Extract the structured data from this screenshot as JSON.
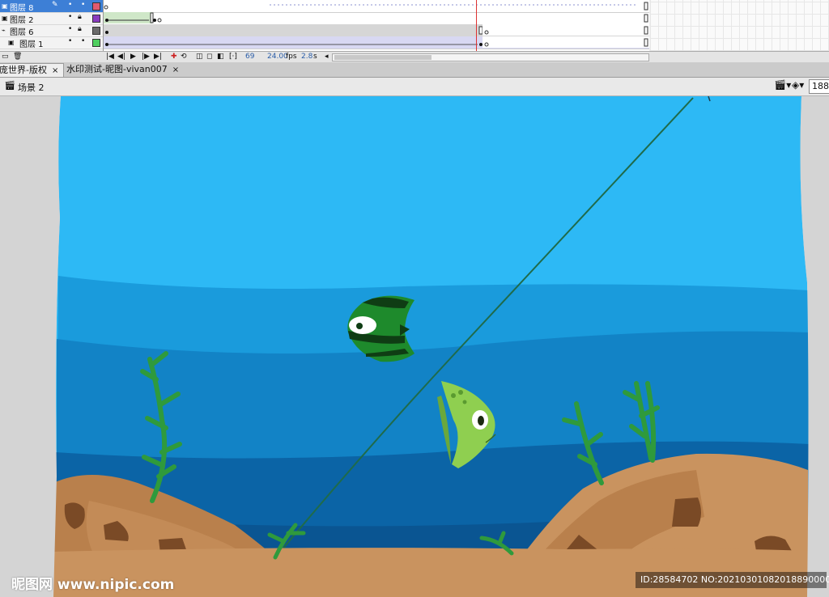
{
  "timeline": {
    "layers": [
      {
        "name": "图层 8",
        "selected": true,
        "color": "#e05a6e",
        "locked": false
      },
      {
        "name": "图层 2",
        "selected": false,
        "color": "#8a3cbf",
        "locked": true
      },
      {
        "name": "图层 6",
        "selected": false,
        "color": "#6b6b6b",
        "locked": true
      },
      {
        "name": "图层 1",
        "selected": false,
        "color": "#4fcf5f",
        "locked": false
      }
    ],
    "frame_number": "69",
    "fps": "24.00",
    "fps_unit": "fps",
    "time": "2.8",
    "time_unit": "s"
  },
  "tabs": [
    {
      "label": "庞世界-版权",
      "close": "×"
    },
    {
      "label": "水印测试-昵图-vivan007",
      "close": "×"
    }
  ],
  "scene": {
    "label": "场景 2",
    "zoom": "188"
  },
  "watermark": {
    "logo_text": "昵图网 www.nipic.com",
    "id_text": "ID:28584702 NO:20210301082018890000"
  },
  "colors": {
    "sky": "#2db9f5",
    "water_mid": "#1a92d6",
    "water_deep": "#0b5ea0",
    "sand": "#c9935f",
    "rock": "#b9804c",
    "rock_spot": "#7a4a26",
    "seaweed": "#2f9a3c",
    "fish_dark": "#1e8a2c",
    "fish_light": "#8fcf50"
  }
}
